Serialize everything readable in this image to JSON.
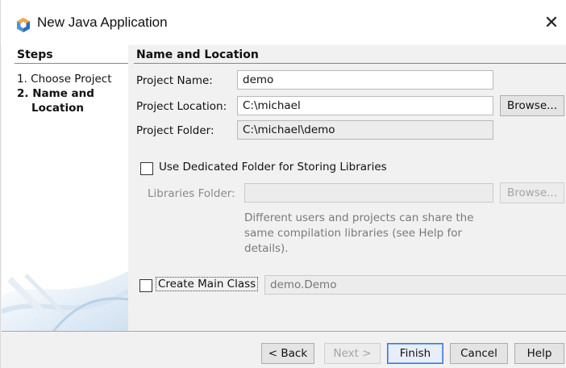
{
  "window": {
    "title": "New Java Application",
    "close_glyph": "✕"
  },
  "sidebar": {
    "header": "Steps",
    "steps": [
      {
        "label": "1. Choose Project"
      },
      {
        "label": "2. Name and"
      },
      {
        "label": "Location"
      }
    ]
  },
  "main": {
    "header": "Name and Location",
    "project_name": {
      "label": "Project Name:",
      "value": "demo"
    },
    "project_location": {
      "label": "Project Location:",
      "value": "C:\\michael",
      "browse_label": "Browse..."
    },
    "project_folder": {
      "label": "Project Folder:",
      "value": "C:\\michael\\demo"
    },
    "dedicated_folder": {
      "label": "Use Dedicated Folder for Storing Libraries",
      "checked": false
    },
    "libraries_folder": {
      "label": "Libraries Folder:",
      "value": "",
      "browse_label": "Browse..."
    },
    "help_text": "Different users and projects can share the same compilation libraries (see Help for details).",
    "create_main_class": {
      "label": "Create Main Class",
      "checked": false,
      "value": "demo.Demo"
    }
  },
  "footer": {
    "back_label": "< Back",
    "next_label": "Next >",
    "finish_label": "Finish",
    "cancel_label": "Cancel",
    "help_label": "Help"
  },
  "icons": {
    "app": "netbeans-project-icon",
    "close": "close-icon"
  },
  "colors": {
    "accent_focus": "#3b78d8",
    "disabled_text": "#a0a0a0"
  }
}
